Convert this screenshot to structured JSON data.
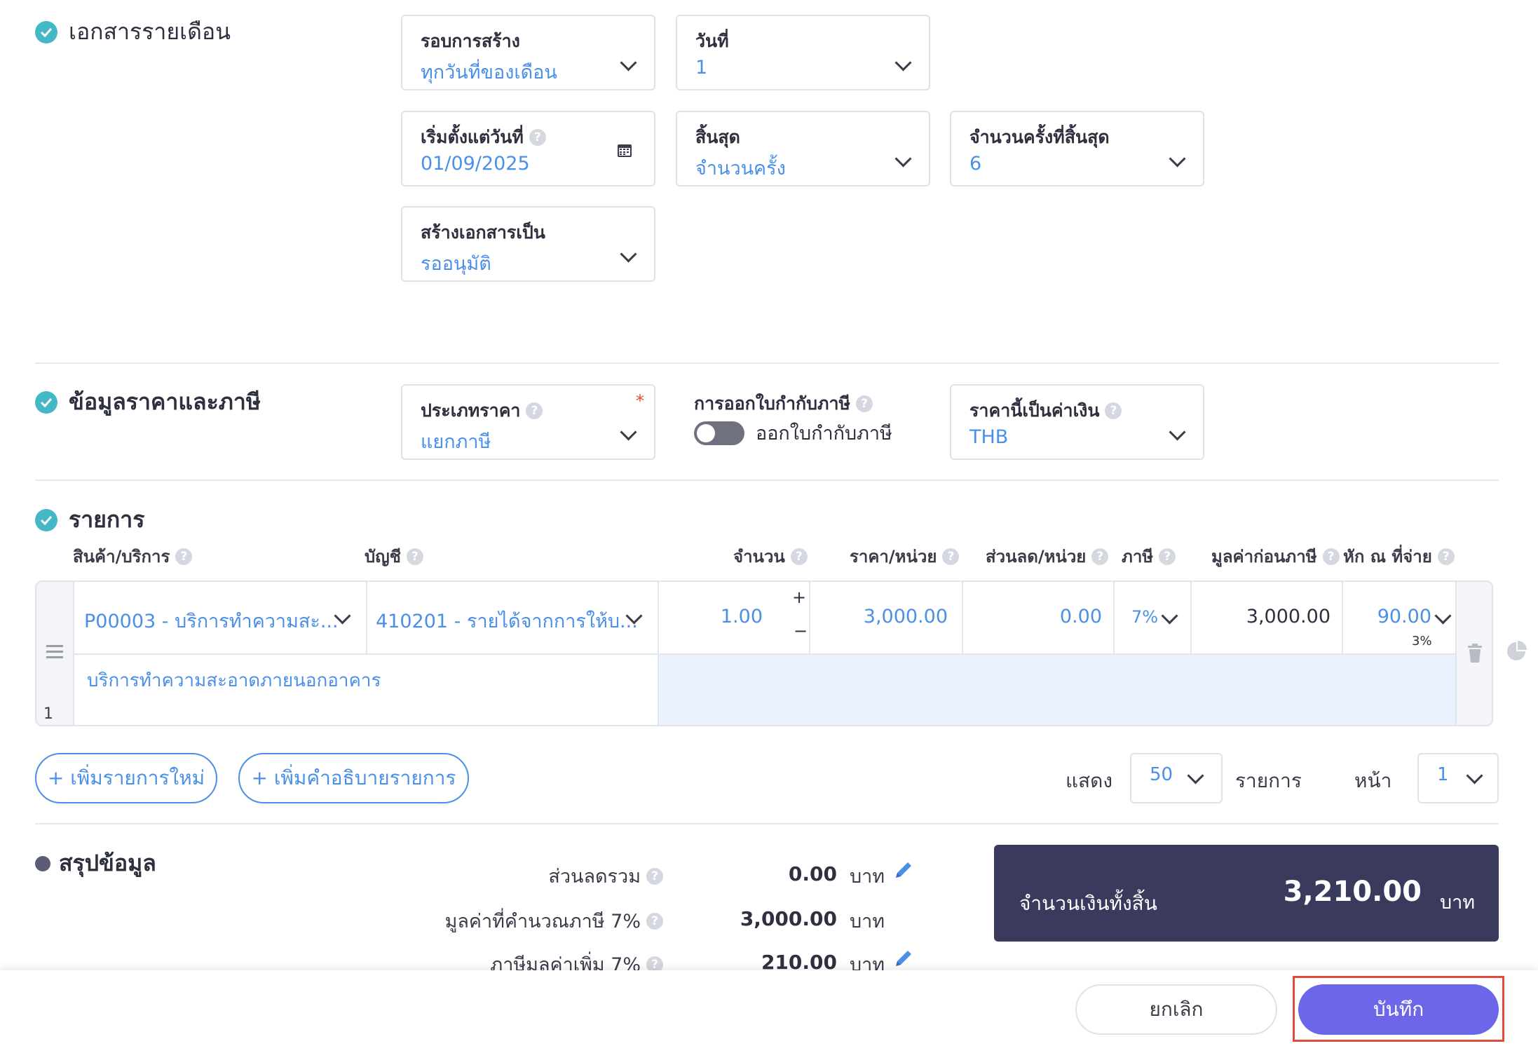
{
  "monthly": {
    "title": "เอกสารรายเดือน",
    "cycle": {
      "label": "รอบการสร้าง",
      "value": "ทุกวันที่ของเดือน"
    },
    "day": {
      "label": "วันที่",
      "value": "1"
    },
    "start": {
      "label": "เริ่มตั้งแต่วันที่",
      "value": "01/09/2025"
    },
    "end": {
      "label": "สิ้นสุด",
      "value": "จำนวนครั้ง"
    },
    "end_count": {
      "label": "จำนวนครั้งที่สิ้นสุด",
      "value": "6"
    },
    "create_as": {
      "label": "สร้างเอกสารเป็น",
      "value": "รออนุมัติ"
    }
  },
  "pricing": {
    "title": "ข้อมูลราคาและภาษี",
    "price_type": {
      "label": "ประเภทราคา",
      "value": "แยกภาษี",
      "required": "*"
    },
    "tax_invoice": {
      "label": "การออกใบกำกับภาษี",
      "toggle_label": "ออกใบกำกับภาษี"
    },
    "currency": {
      "label": "ราคานี้เป็นค่าเงิน",
      "value": "THB"
    }
  },
  "items": {
    "title": "รายการ",
    "headers": {
      "product": "สินค้า/บริการ",
      "account": "บัญชี",
      "qty": "จำนวน",
      "unit_price": "ราคา/หน่วย",
      "discount": "ส่วนลด/หน่วย",
      "tax": "ภาษี",
      "pre_tax": "มูลค่าก่อนภาษี",
      "wht": "หัก ณ ที่จ่าย"
    },
    "row": {
      "number": "1",
      "product": "P00003 - บริการทำความสะ...",
      "account": "410201 - รายได้จากการให้บ...",
      "qty": "1.00",
      "unit_price": "3,000.00",
      "discount": "0.00",
      "tax": "7%",
      "pre_tax": "3,000.00",
      "wht": "90.00",
      "wht_rate": "3%",
      "description": "บริการทำความสะอาดภายนอกอาคาร"
    },
    "add_item": "+ เพิ่มรายการใหม่",
    "add_desc": "+ เพิ่มคำอธิบายรายการ",
    "show_label": "แสดง",
    "show_value": "50",
    "items_label": "รายการ",
    "page_label": "หน้า",
    "page_value": "1"
  },
  "summary": {
    "title": "สรุปข้อมูล",
    "discount_total": {
      "label": "ส่วนลดรวม",
      "value": "0.00",
      "unit": "บาท"
    },
    "taxable": {
      "label": "มูลค่าที่คำนวณภาษี 7%",
      "value": "3,000.00",
      "unit": "บาท"
    },
    "vat": {
      "label": "ภาษีมูลค่าเพิ่ม 7%",
      "value": "210.00",
      "unit": "บาท"
    },
    "grand_total": {
      "label": "จำนวนเงินทั้งสิ้น",
      "value": "3,210.00",
      "unit": "บาท"
    }
  },
  "footer": {
    "cancel": "ยกเลิก",
    "save": "บันทึก"
  },
  "colors": {
    "accent": "#4a8fe8",
    "check": "#45b8c8",
    "total_bg": "#3a3a5c",
    "save_btn": "#6d66e8",
    "highlight": "#e04a3a"
  }
}
